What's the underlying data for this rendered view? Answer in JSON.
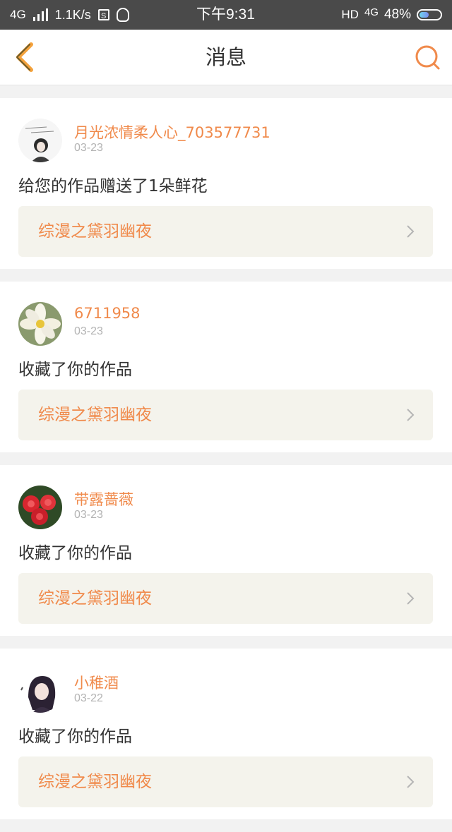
{
  "status_bar": {
    "network": "4G",
    "speed": "1.1K/s",
    "s_icon_text": "S",
    "time": "下午9:31",
    "hd": "HD",
    "network_right": "4G",
    "battery": "48%",
    "battery_level": 0.48
  },
  "header": {
    "title": "消息",
    "back_icon": "chevron-left-icon",
    "search_icon": "search-icon",
    "accent_color": "#f08a4b"
  },
  "messages": [
    {
      "username": "月光浓情柔人心_703577731",
      "date": "03-23",
      "action": "给您的作品赠送了1朵鲜花",
      "work_title": "综漫之黛羽幽夜",
      "avatar": "sketch-girl-avatar"
    },
    {
      "username": "6711958",
      "date": "03-23",
      "action": "收藏了你的作品",
      "work_title": "综漫之黛羽幽夜",
      "avatar": "white-flower-avatar"
    },
    {
      "username": "带露蔷薇",
      "date": "03-23",
      "action": "收藏了你的作品",
      "work_title": "综漫之黛羽幽夜",
      "avatar": "red-roses-avatar"
    },
    {
      "username": "小稚酒",
      "date": "03-22",
      "action": "收藏了你的作品",
      "work_title": "综漫之黛羽幽夜",
      "avatar": "anime-girl-avatar"
    }
  ]
}
